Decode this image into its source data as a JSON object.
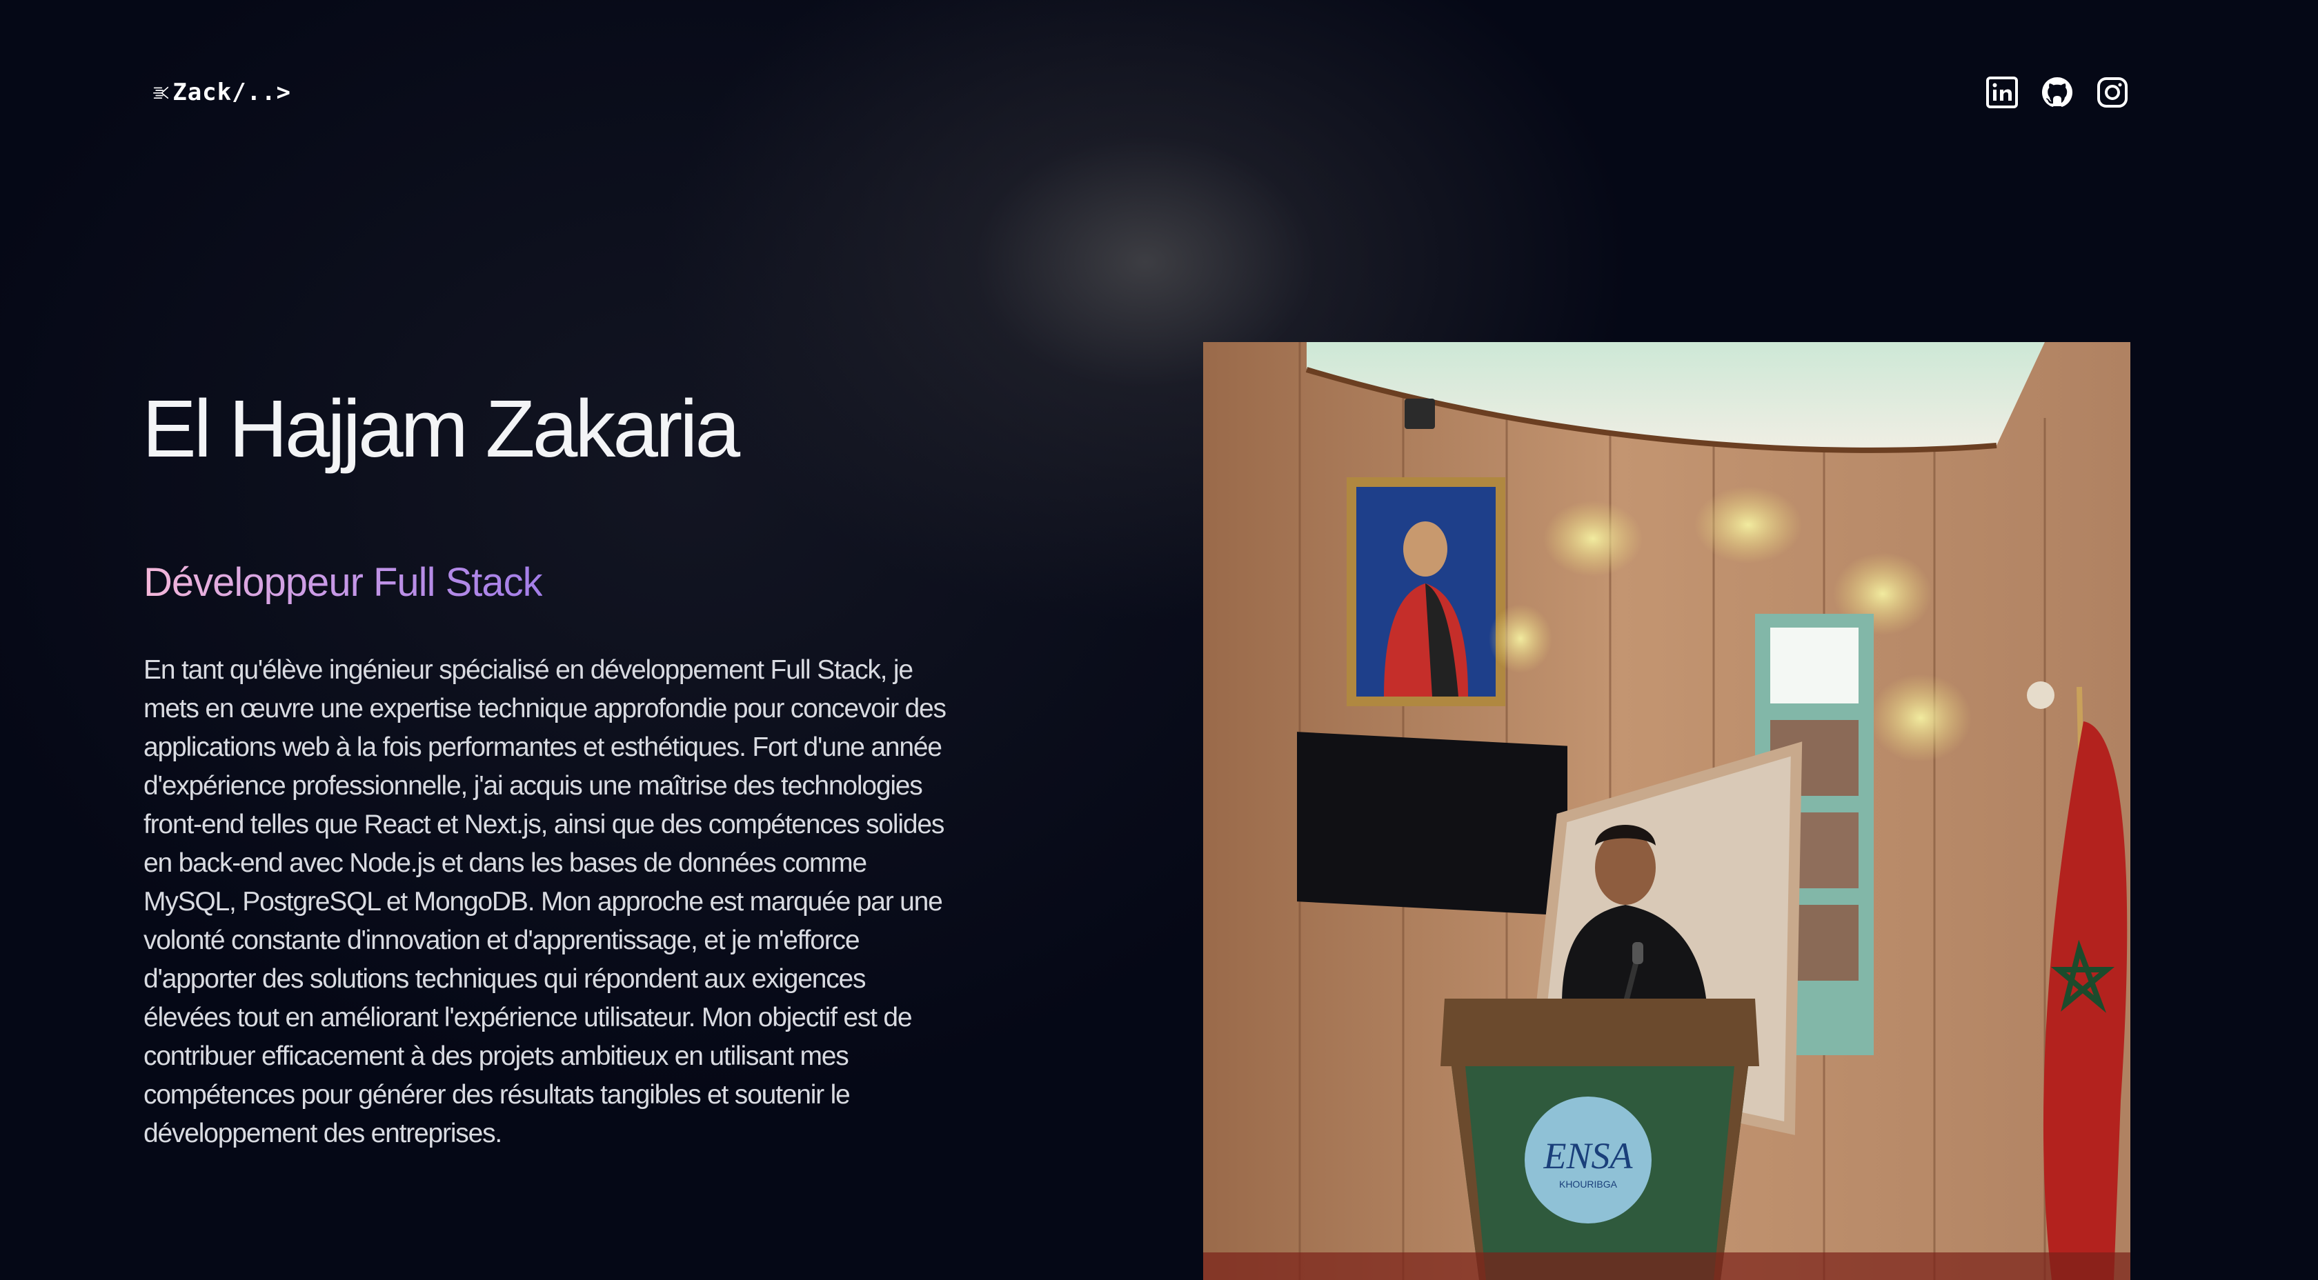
{
  "header": {
    "logo": {
      "text": "Zack/..>",
      "icon": "speed-lines-logo-icon"
    },
    "socials": [
      {
        "name": "linkedin",
        "icon": "linkedin-icon"
      },
      {
        "name": "github",
        "icon": "github-icon"
      },
      {
        "name": "instagram",
        "icon": "instagram-icon"
      }
    ]
  },
  "hero": {
    "name": "El Hajjam Zakaria",
    "role": "Développeur Full Stack",
    "bio": "En tant qu'élève ingénieur spécialisé en développement Full Stack, je mets en œuvre une expertise technique approfondie pour concevoir des applications web à la fois performantes et esthétiques. Fort d'une année d'expérience professionnelle, j'ai acquis une maîtrise des technologies front-end telles que React et Next.js, ainsi que des compétences solides en back-end avec Node.js et dans les bases de données comme MySQL, PostgreSQL et MongoDB. Mon approche est marquée par une volonté constante d'innovation et d'apprentissage, et je m'efforce d'apporter des solutions techniques qui répondent aux exigences élevées tout en améliorant l'expérience utilisateur. Mon objectif est de contribuer efficacement à des projets ambitieux en utilisant mes compétences pour générer des résultats tangibles et soutenir le développement des entreprises."
  },
  "photo": {
    "podium_logo_text": "ENSA",
    "podium_logo_subtext": "KHOURIBGA"
  },
  "colors": {
    "background": "#050816",
    "role_gradient_start": "#f4b8d9",
    "role_gradient_end": "#a37ee8",
    "text": "#d9dbe1"
  }
}
